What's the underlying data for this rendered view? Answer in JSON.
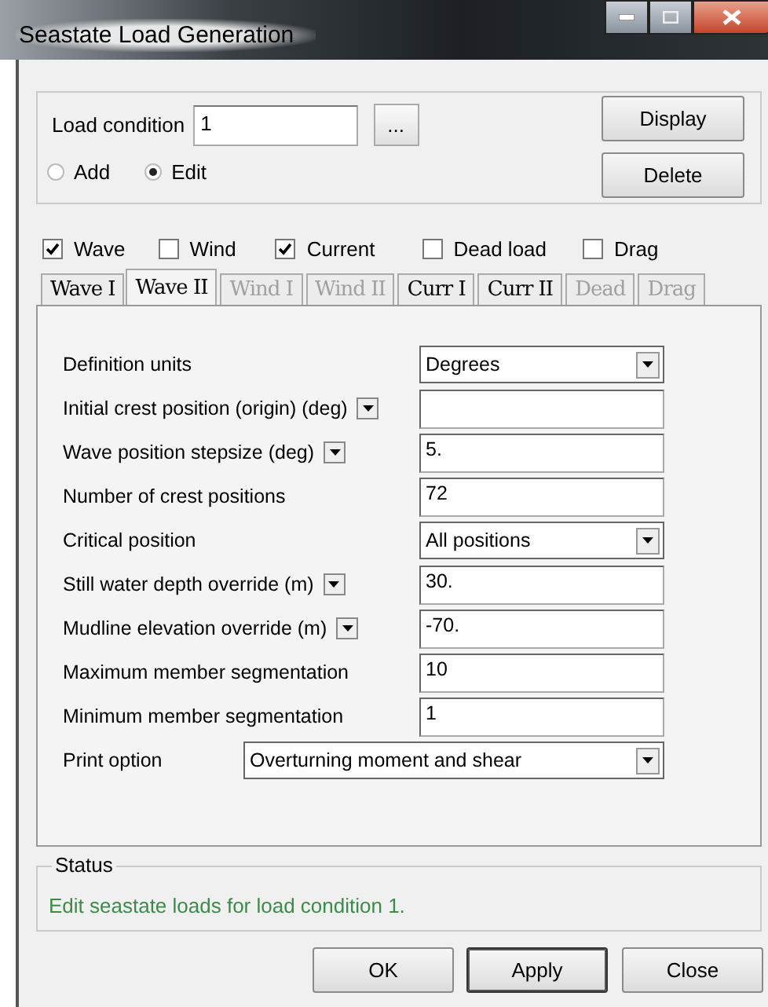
{
  "window": {
    "title": "Seastate Load Generation"
  },
  "load_condition": {
    "label": "Load condition",
    "value": "1",
    "browse": "..."
  },
  "mode": [
    {
      "label": "Add",
      "selected": false
    },
    {
      "label": "Edit",
      "selected": true
    }
  ],
  "actions": [
    "Display",
    "Delete"
  ],
  "load_types": [
    {
      "label": "Wave",
      "checked": true
    },
    {
      "label": "Wind",
      "checked": false
    },
    {
      "label": "Current",
      "checked": true
    },
    {
      "label": "Dead load",
      "checked": false
    },
    {
      "label": "Drag",
      "checked": false
    }
  ],
  "tabs": [
    {
      "label": "Wave I",
      "selected": false,
      "disabled": false
    },
    {
      "label": "Wave II",
      "selected": true,
      "disabled": false
    },
    {
      "label": "Wind I",
      "selected": false,
      "disabled": true
    },
    {
      "label": "Wind II",
      "selected": false,
      "disabled": true
    },
    {
      "label": "Curr I",
      "selected": false,
      "disabled": false
    },
    {
      "label": "Curr II",
      "selected": false,
      "disabled": false
    },
    {
      "label": "Dead",
      "selected": false,
      "disabled": true
    },
    {
      "label": "Drag",
      "selected": false,
      "disabled": true
    }
  ],
  "fields": [
    {
      "kind": "select",
      "label": "Definition units",
      "value": "Degrees",
      "unit_menu": false
    },
    {
      "kind": "input",
      "label": "Initial crest position (origin)  (deg)",
      "unit_menu": true
    },
    {
      "kind": "input",
      "label": "Wave position stepsize  (deg)",
      "value": "5.",
      "unit_menu": true
    },
    {
      "kind": "input",
      "label": "Number of crest positions",
      "value": "72",
      "unit_menu": false
    },
    {
      "kind": "select",
      "label": "Critical position",
      "value": "All positions",
      "unit_menu": false
    },
    {
      "kind": "input",
      "label": "Still water depth override  (m)",
      "value": "30.",
      "unit_menu": true
    },
    {
      "kind": "input",
      "label": "Mudline elevation override  (m)",
      "value": "-70.",
      "unit_menu": true
    },
    {
      "kind": "input",
      "label": "Maximum member segmentation",
      "value": "10",
      "unit_menu": false
    },
    {
      "kind": "input",
      "label": "Minimum member segmentation",
      "value": "1",
      "unit_menu": false
    },
    {
      "kind": "wide_select",
      "label": "Print option",
      "value": "Overturning moment and shear",
      "unit_menu": false
    }
  ],
  "status": {
    "title": "Status",
    "message": "Edit seastate loads for load condition 1."
  },
  "buttons": [
    {
      "label": "OK",
      "default": false
    },
    {
      "label": "Apply",
      "default": true
    },
    {
      "label": "Close",
      "default": false
    }
  ]
}
